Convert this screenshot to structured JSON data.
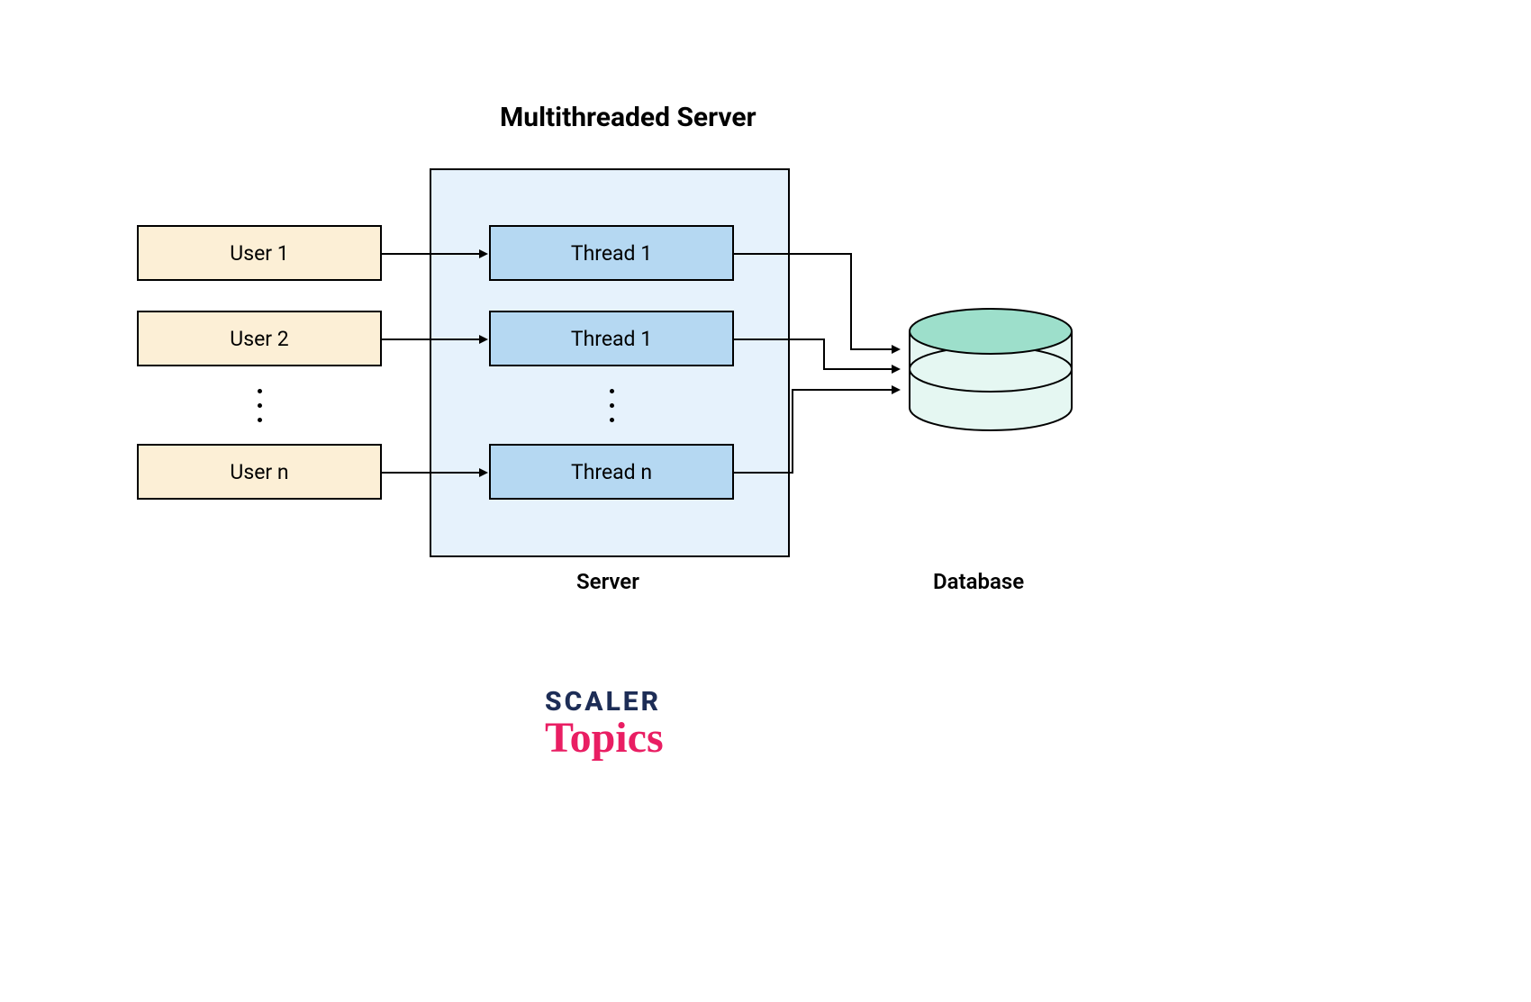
{
  "title": "Multithreaded Server",
  "users": {
    "u1": "User 1",
    "u2": "User 2",
    "un": "User n"
  },
  "threads": {
    "t1": "Thread 1",
    "t2": "Thread 1",
    "tn": "Thread n"
  },
  "labels": {
    "server": "Server",
    "database": "Database"
  },
  "logo": {
    "line1": "SCALER",
    "line2": "Topics"
  }
}
